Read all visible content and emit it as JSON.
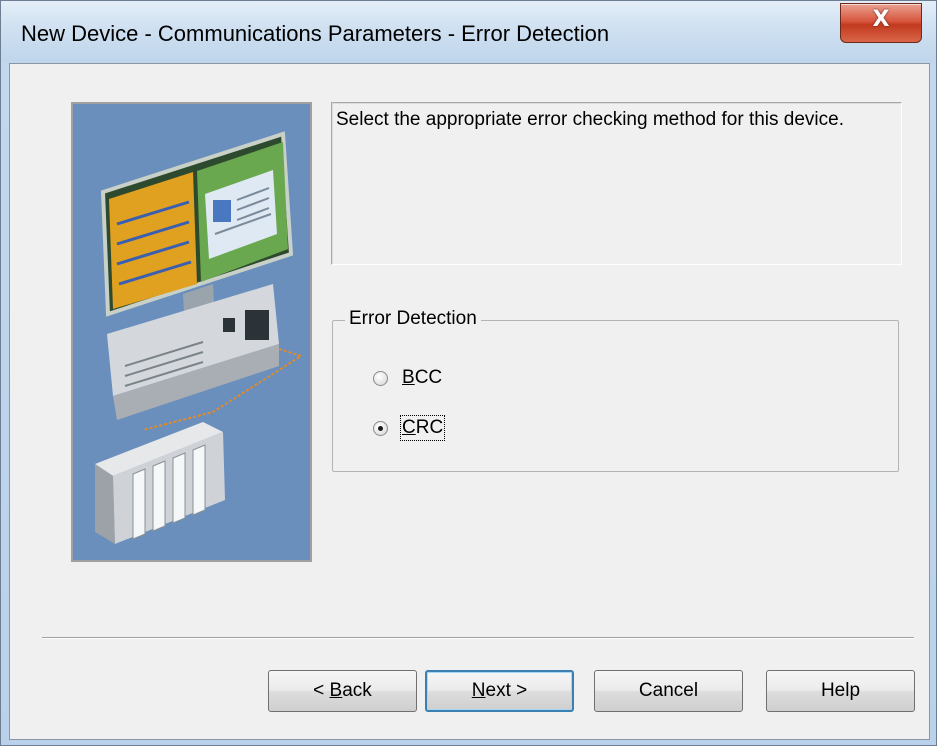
{
  "window": {
    "title": "New Device - Communications Parameters - Error Detection",
    "close_glyph": "X"
  },
  "description": "Select the appropriate error checking method for this device.",
  "error_detection": {
    "legend": "Error Detection",
    "options": [
      {
        "label_mnemonic": "B",
        "label_rest": "CC",
        "selected": false
      },
      {
        "label_mnemonic": "C",
        "label_rest": "RC",
        "selected": true
      }
    ]
  },
  "buttons": {
    "back_prefix": "< ",
    "back_mnemonic": "B",
    "back_rest": "ack",
    "next_mnemonic": "N",
    "next_rest": "ext >",
    "cancel": "Cancel",
    "help": "Help"
  },
  "colors": {
    "illustration_bg": "#6a8fbd",
    "default_button_border": "#3c7fb1",
    "close_button": "#c23a1f"
  },
  "icons": {
    "close": "close-icon",
    "illustration": "computer-plc-illustration"
  }
}
